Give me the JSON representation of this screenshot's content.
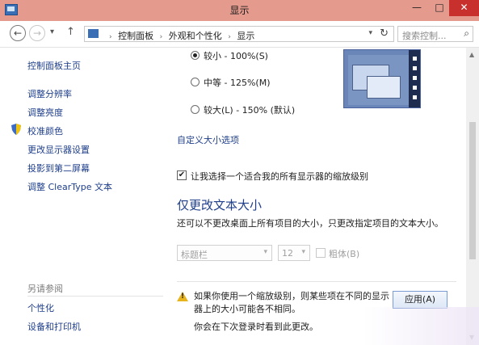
{
  "window": {
    "title": "显示",
    "minimize": "—",
    "maximize": "□",
    "close": "✕"
  },
  "nav": {
    "back_icon": "←",
    "forward_icon": "→",
    "recent_icon": "▾",
    "up_icon": "↑"
  },
  "address": {
    "crumbs": [
      "控制面板",
      "外观和个性化",
      "显示"
    ],
    "separator": "›",
    "dropdown_icon": "▾",
    "refresh_icon": "↻"
  },
  "search": {
    "placeholder": "搜索控制...",
    "icon": "⌕"
  },
  "sidebar": {
    "home": "控制面板主页",
    "items": [
      "调整分辨率",
      "调整亮度",
      "校准颜色",
      "更改显示器设置",
      "投影到第二屏幕",
      "调整 ClearType 文本"
    ],
    "see_also": "另请参阅",
    "see_also_items": [
      "个性化",
      "设备和打印机"
    ]
  },
  "sizes": {
    "options": [
      {
        "label": "较小 - 100%(S)",
        "selected": true
      },
      {
        "label": "中等 - 125%(M)",
        "selected": false
      },
      {
        "label": "较大(L) - 150% (默认)",
        "selected": false
      }
    ],
    "custom_link": "自定义大小选项"
  },
  "scaling_checkbox": {
    "label": "让我选择一个适合我的所有显示器的缩放级别",
    "checked": true,
    "mark": "✔"
  },
  "text_size": {
    "heading": "仅更改文本大小",
    "description": "还可以不更改桌面上所有项目的大小，只更改指定项目的文本大小。",
    "item_select": "标题栏",
    "size_select": "12",
    "arrow": "▾",
    "bold_label": "粗体(B)"
  },
  "warning": {
    "icon": "!",
    "text": "如果你使用一个缩放级别，则某些项在不同的显示器上的大小可能各不相同。",
    "relogin": "你会在下次登录时看到此更改。"
  },
  "apply_button": "应用(A)",
  "scrollbar": {
    "up": "▲",
    "down": "▼"
  }
}
